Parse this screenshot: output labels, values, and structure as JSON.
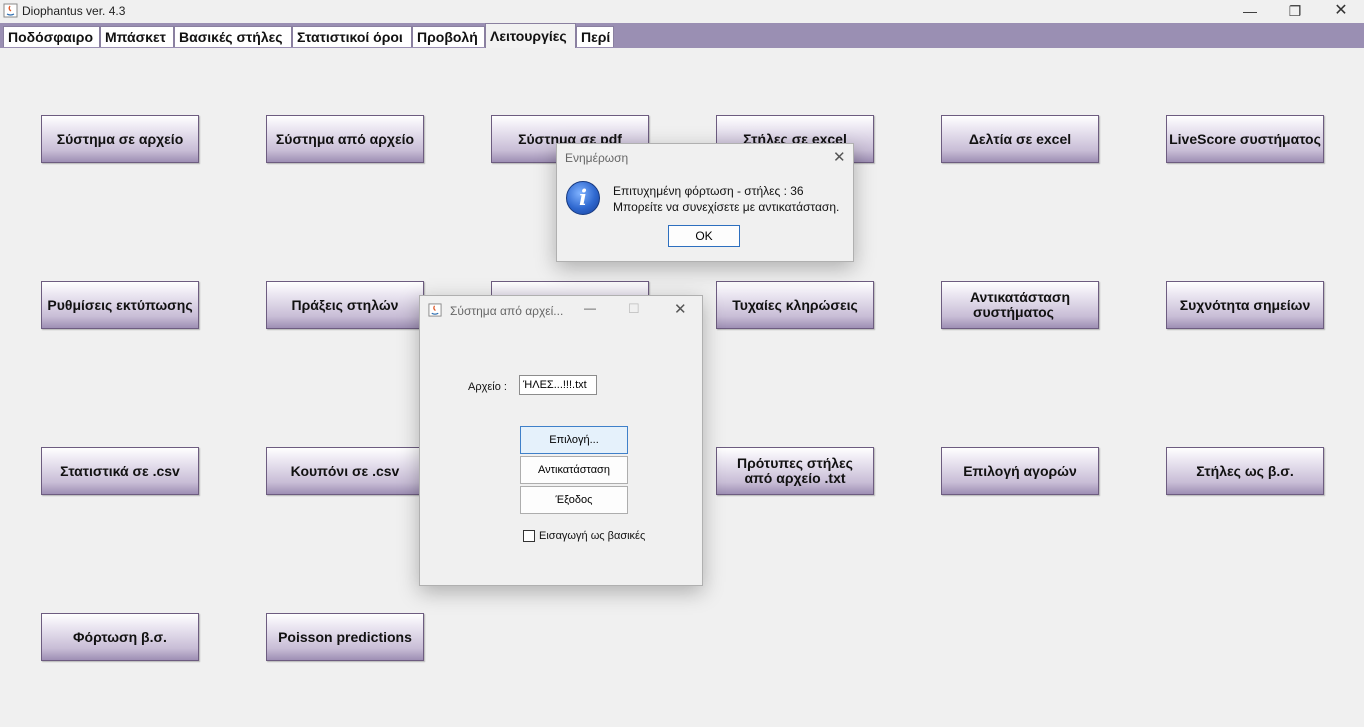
{
  "window": {
    "title": "Diophantus ver. 4.3",
    "min": "—",
    "max": "❐",
    "close": "✕"
  },
  "tabs": [
    {
      "label": "Ποδόσφαιρο"
    },
    {
      "label": "Μπάσκετ"
    },
    {
      "label": "Βασικές στήλες"
    },
    {
      "label": "Στατιστικοί όροι"
    },
    {
      "label": "Προβολή"
    },
    {
      "label": "Λειτουργίες",
      "active": true
    },
    {
      "label": "Περί"
    }
  ],
  "buttons": {
    "row1": [
      "Σύστημα σε αρχείο",
      "Σύστημα από αρχείο",
      "Σύστημα σε pdf",
      "Στήλες σε excel",
      "Δελτία σε excel",
      "LiveScore συστήματος"
    ],
    "row2": [
      "Ρυθμίσεις εκτύπωσης",
      "Πράξεις στηλών",
      "",
      "Τυχαίες κληρώσεις",
      "Αντικατάσταση συστήματος",
      "Συχνότητα σημείων"
    ],
    "row3": [
      "Στατιστικά σε .csv",
      "Κουπόνι σε .csv",
      "",
      "Πρότυπες στήλες από αρχείο .txt",
      "Επιλογή αγορών",
      "Στήλες ως β.σ."
    ],
    "row4": [
      "Φόρτωση β.σ.",
      "Poisson predictions"
    ],
    "antikatastasi_line1": "Αντικατάσταση",
    "antikatastasi_line2": "συστήματος",
    "protypes_line1": "Πρότυπες στήλες",
    "protypes_line2": "από αρχείο .txt"
  },
  "info_dialog": {
    "title": "Ενημέρωση",
    "close": "✕",
    "icon_name": "info-icon",
    "icon_glyph": "i",
    "line1": "Επιτυχημένη φόρτωση - στήλες : 36",
    "line2": "Μπορείτε να συνεχίσετε με αντικατάσταση.",
    "ok": "OK"
  },
  "file_dialog": {
    "title": "Σύστημα από αρχεί...",
    "min": "—",
    "max": "☐",
    "close": "✕",
    "file_label": "Αρχείο :",
    "file_value": "ΉΛΕΣ...!!!.txt",
    "btn_select": "Επιλογή...",
    "btn_replace": "Αντικατάσταση",
    "btn_exit": "Έξοδος",
    "checkbox_label": "Εισαγωγή ως βασικές",
    "checkbox_checked": false
  },
  "colors": {
    "tab_strip": "#9a8fb3",
    "button_bottom": "#9e8fb4",
    "focus_blue": "#3f80c9"
  }
}
